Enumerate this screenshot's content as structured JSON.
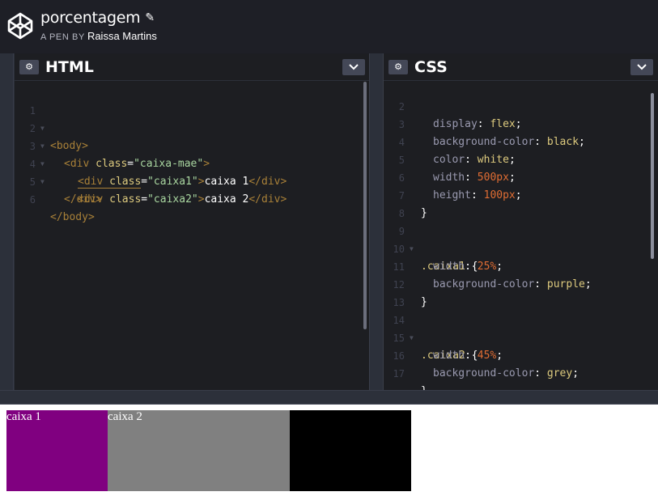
{
  "header": {
    "title": "porcentagem",
    "edit_icon": "pencil-icon",
    "by_label": "A PEN BY",
    "author": "Raissa Martins",
    "logo": "codepen-logo"
  },
  "html_pane": {
    "label": "HTML",
    "lines": [
      {
        "n": "1",
        "fold": true
      },
      {
        "n": "2",
        "fold": true
      },
      {
        "n": "3",
        "fold": true
      },
      {
        "n": "4",
        "fold": true
      },
      {
        "n": "5",
        "fold": false
      },
      {
        "n": "6",
        "fold": false
      }
    ],
    "code": {
      "l1": "<body>",
      "l2_open": "<div ",
      "l2_attr": "class",
      "l2_eq": "=",
      "l2_str": "\"caixa-mae\"",
      "l2_close": ">",
      "l3_open": "<div ",
      "l3_attr": "class",
      "l3_eq": "=",
      "l3_str": "\"caixa1\"",
      "l3_gt": ">",
      "l3_text": "caixa 1",
      "l3_end": "</div>",
      "l4_open": "<div ",
      "l4_attr": "class",
      "l4_eq": "=",
      "l4_str": "\"caixa2\"",
      "l4_gt": ">",
      "l4_text": "caixa 2",
      "l4_end": "</div>",
      "l5": "</div>",
      "l6": "</body>"
    }
  },
  "css_pane": {
    "label": "CSS",
    "lines": [
      {
        "n": "2"
      },
      {
        "n": "3"
      },
      {
        "n": "4"
      },
      {
        "n": "5"
      },
      {
        "n": "6"
      },
      {
        "n": "7"
      },
      {
        "n": "8"
      },
      {
        "n": "9"
      },
      {
        "n": "10"
      },
      {
        "n": "11"
      },
      {
        "n": "12"
      },
      {
        "n": "13"
      },
      {
        "n": "14"
      },
      {
        "n": "15"
      },
      {
        "n": "16"
      },
      {
        "n": "17"
      }
    ],
    "code": {
      "display_prop": "display",
      "display_val": "flex",
      "bg_prop": "background-color",
      "bg_val": "black",
      "color_prop": "color",
      "color_val": "white",
      "width_prop": "width",
      "width_val": "500px",
      "height_prop": "height",
      "height_val": "100px",
      "close": "}",
      "sel1": ".caixa1",
      "brace": "{",
      "c1_width_val": "25%",
      "c1_bg_val": "purple",
      "sel2": ".caixa2",
      "c2_width_val": "45%",
      "c2_bg_val": "grey"
    }
  },
  "result": {
    "caixa1": "caixa 1",
    "caixa2": "caixa 2",
    "colors": {
      "caixa_mae": "#000000",
      "caixa1": "#800080",
      "caixa2": "#808080"
    }
  },
  "icons": {
    "settings": "gear-icon",
    "collapse": "chevron-down-icon"
  }
}
